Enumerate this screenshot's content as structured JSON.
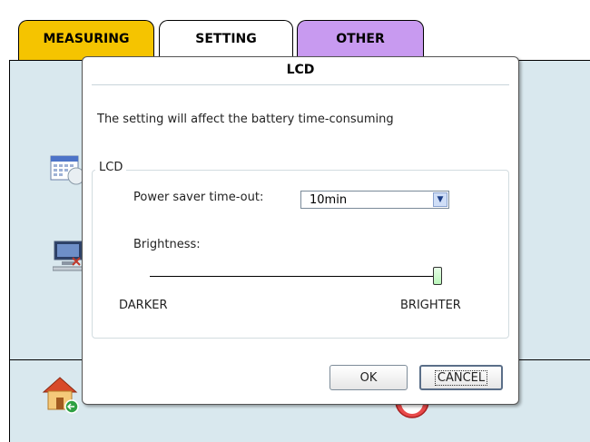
{
  "tabs": [
    {
      "label": "MEASURING",
      "color": "#f5c400"
    },
    {
      "label": "SETTING",
      "color": "#ffffff"
    },
    {
      "label": "OTHER",
      "color": "#c89af0"
    }
  ],
  "panel": {
    "background": "#d9e8ee"
  },
  "dialog": {
    "title": "LCD",
    "info": "The setting will affect the battery time-consuming",
    "group_label": "LCD",
    "timeout_label": "Power saver time-out:",
    "timeout_value": "10min",
    "brightness_label": "Brightness:",
    "brightness_level": 1.0,
    "darker_label": "DARKER",
    "brighter_label": "BRIGHTER",
    "ok_label": "OK",
    "cancel_label": "CANCEL"
  },
  "icons": {
    "calendar": "calendar-clock-icon",
    "network": "network-computer-icon",
    "home": "home-icon",
    "stop": "stop-icon"
  }
}
